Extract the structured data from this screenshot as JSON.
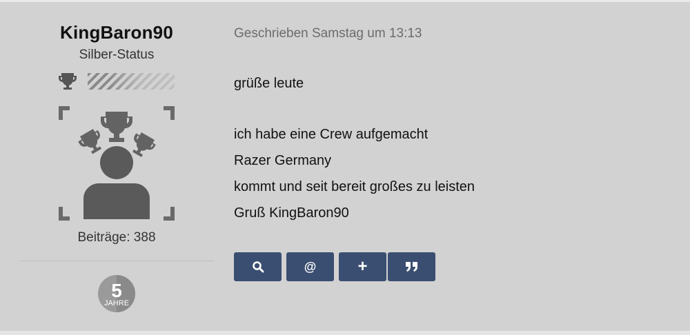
{
  "author": {
    "username": "KingBaron90",
    "rank": "Silber-Status",
    "posts_label": "Beiträge: 388",
    "membership_years": "5",
    "membership_unit": "JAHRE"
  },
  "post": {
    "meta": "Geschrieben Samstag um 13:13",
    "lines": [
      "grüße leute",
      "",
      "ich habe eine Crew aufgemacht",
      "Razer Germany",
      "kommt und seit bereit großes zu leisten",
      "Gruß KingBaron90"
    ]
  },
  "actions": [
    {
      "icon": "search-icon"
    },
    {
      "icon": "mention-icon",
      "glyph": "@"
    },
    {
      "icon": "plus-icon",
      "glyph": "+"
    },
    {
      "icon": "quote-icon",
      "glyph": "❞"
    }
  ],
  "colors": {
    "background": "#d2d2d2",
    "button": "#3a4e71",
    "icon_gray": "#555555"
  }
}
